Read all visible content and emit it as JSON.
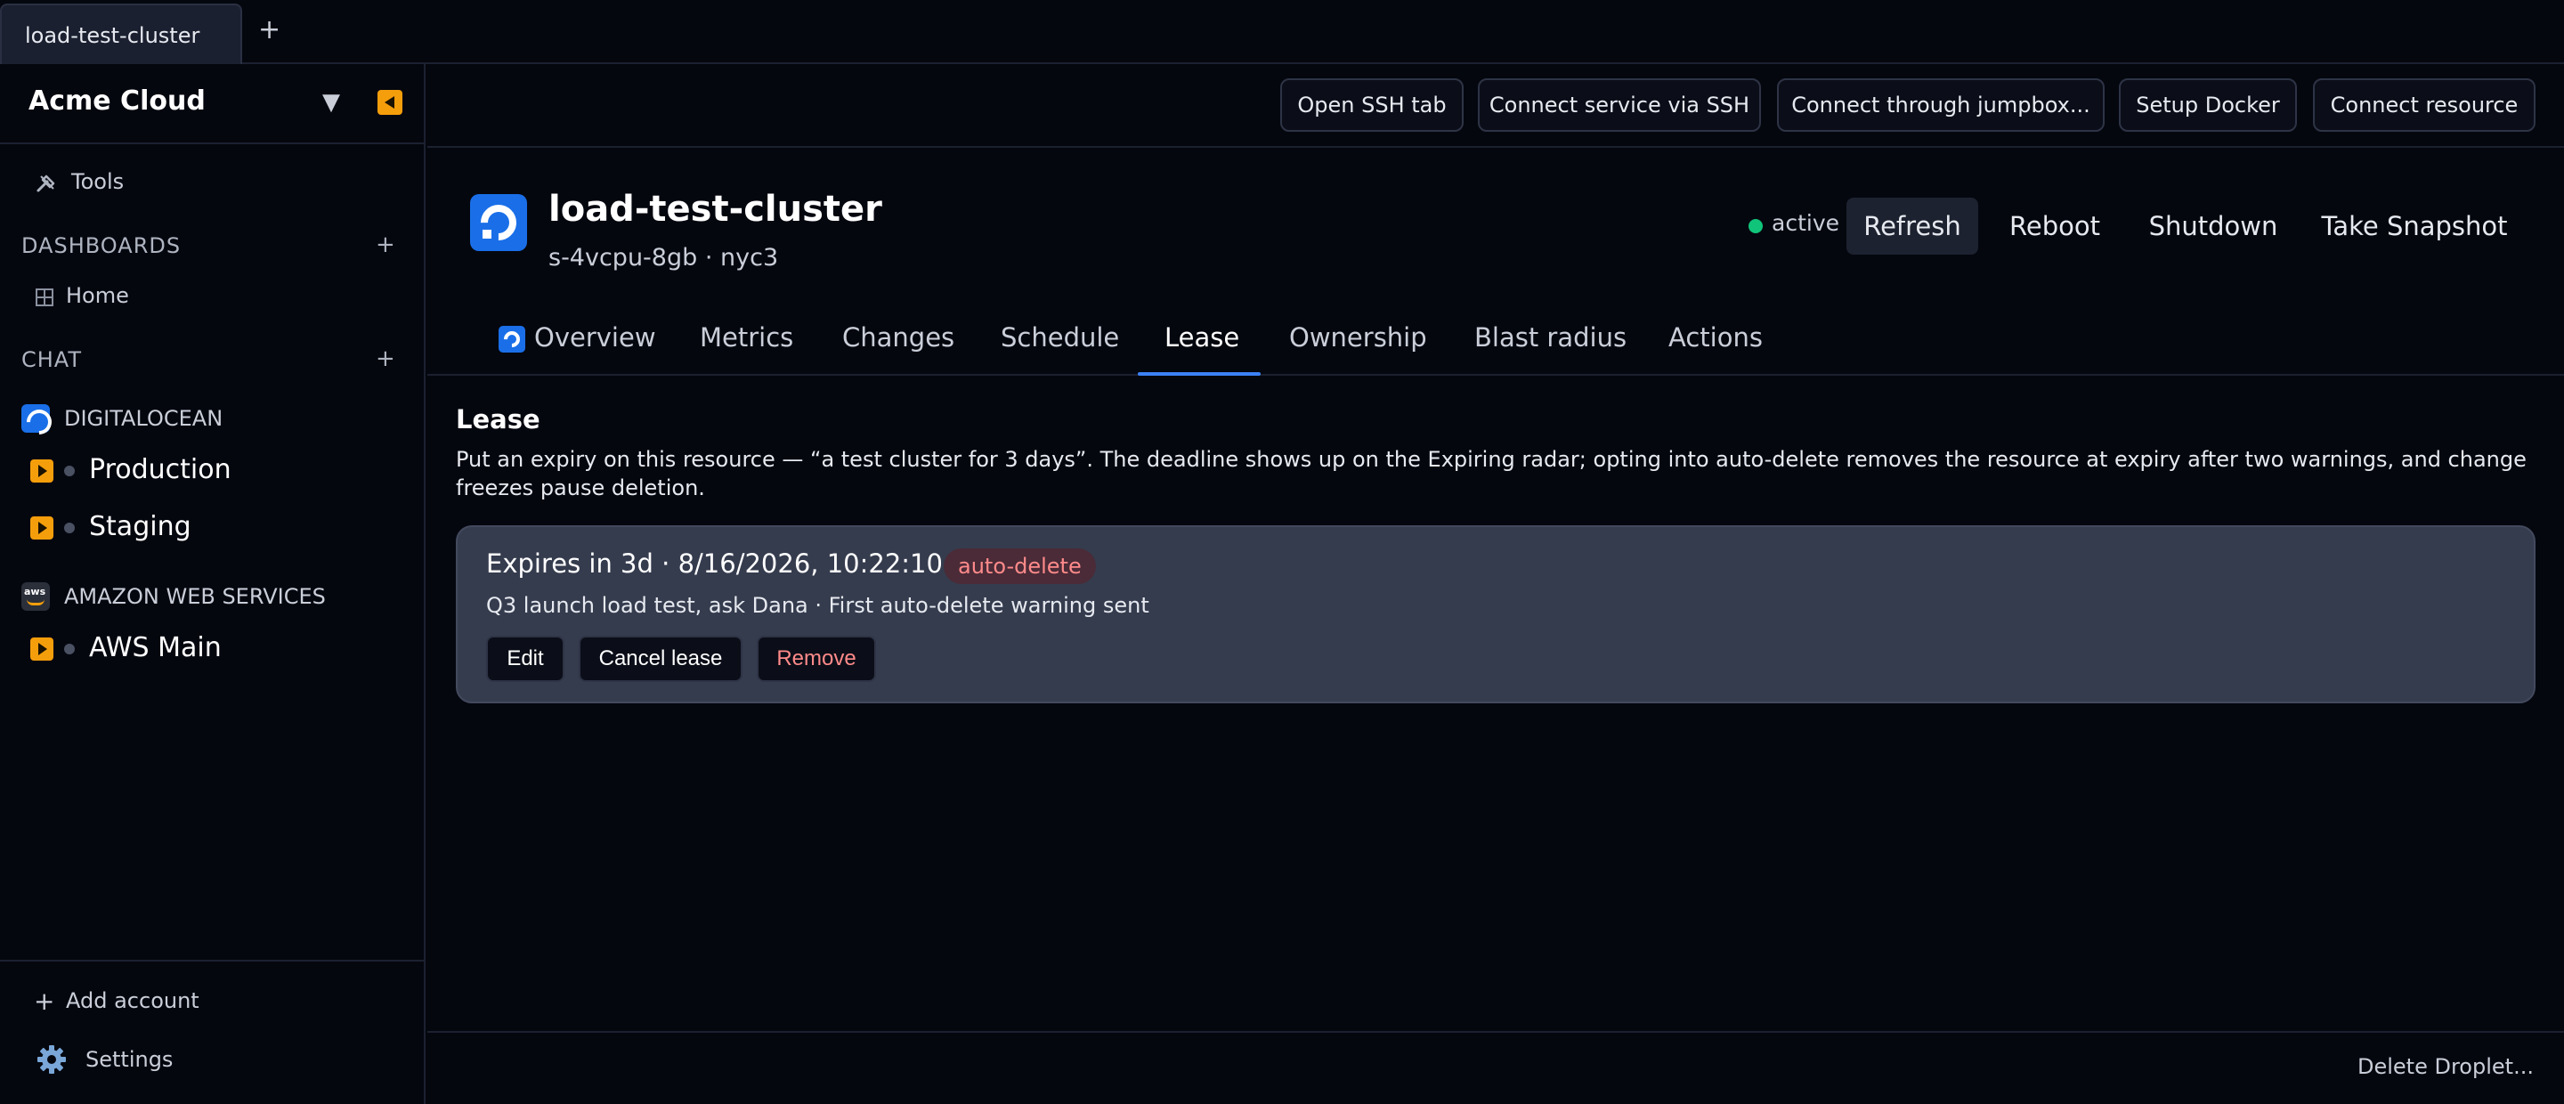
{
  "window": {
    "tab_label": "load-test-cluster",
    "new_tab_glyph": "+"
  },
  "sidebar": {
    "account_name": "Acme Cloud",
    "account_dropdown_glyph": "▼",
    "tools_label": "Tools",
    "dashboards_title": "DASHBOARDS",
    "dashboards_add": "+",
    "home_label": "Home",
    "chat_title": "CHAT",
    "chat_add": "+",
    "providers": [
      {
        "name": "DIGITALOCEAN",
        "icon": "digitalocean-icon",
        "environments": [
          "Production",
          "Staging"
        ]
      },
      {
        "name": "AMAZON WEB SERVICES",
        "icon": "aws-icon",
        "environments": [
          "AWS Main"
        ]
      }
    ],
    "add_account_label": "Add account",
    "settings_label": "Settings"
  },
  "toolbar": {
    "buttons": [
      "Open SSH tab",
      "Connect service via SSH",
      "Connect through jumpbox...",
      "Setup Docker",
      "Connect resource"
    ]
  },
  "resource": {
    "title": "load-test-cluster",
    "subtitle": "s-4vcpu-8gb · nyc3",
    "status": "active",
    "status_color": "#10c47a",
    "actions": [
      "Refresh",
      "Reboot",
      "Shutdown",
      "Take Snapshot"
    ]
  },
  "tabs": [
    "Overview",
    "Metrics",
    "Changes",
    "Schedule",
    "Lease",
    "Ownership",
    "Blast radius",
    "Actions"
  ],
  "active_tab": "Lease",
  "lease": {
    "title": "Lease",
    "description": "Put an expiry on this resource — “a test cluster for 3 days”. The deadline shows up on the Expiring radar; opting into auto-delete removes the resource at expiry after two warnings, and change freezes pause deletion.",
    "expiry": "Expires in 3d · 8/16/2026, 10:22:10 PM",
    "badge": "auto-delete",
    "note": "Q3 launch load test, ask Dana · First auto-delete warning sent",
    "buttons": {
      "edit": "Edit",
      "cancel": "Cancel lease",
      "remove": "Remove"
    }
  },
  "footer": {
    "delete_label": "Delete Droplet..."
  },
  "colors": {
    "accent": "#3b82f6",
    "warning": "#f59e0b",
    "danger_text": "#ff8a8a"
  }
}
